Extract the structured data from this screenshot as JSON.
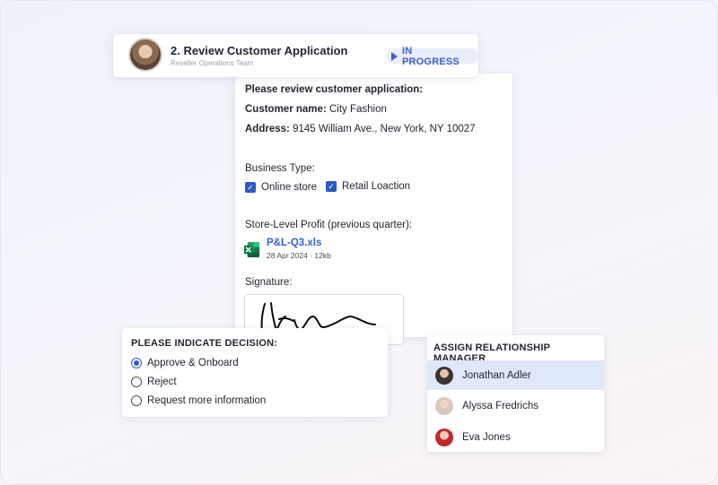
{
  "task": {
    "title": "2. Review Customer Application",
    "team": "Reseller Operations Team",
    "status": "IN PROGRESS",
    "status_color": "#3f5fc4"
  },
  "form": {
    "intro": "Please review customer application:",
    "customer_label": "Customer name:",
    "customer_value": "City Fashion",
    "address_label": "Address:",
    "address_value": "9145 William Ave., New York, NY 10027",
    "business_type_label": "Business Type:",
    "business_types": [
      {
        "label": "Online store",
        "checked": true
      },
      {
        "label": "Retail Loaction",
        "checked": true
      }
    ],
    "profit_label": "Store-Level Profit (previous quarter):",
    "file": {
      "name": "P&L-Q3.xls",
      "meta": "28 Apr 2024 · 12kb",
      "icon": "excel-file-icon"
    },
    "signature_label": "Signature:"
  },
  "decision": {
    "title": "PLEASE INDICATE DECISION:",
    "options": [
      {
        "label": "Approve & Onboard",
        "selected": true
      },
      {
        "label": "Reject",
        "selected": false
      },
      {
        "label": "Request more information",
        "selected": false
      }
    ]
  },
  "manager": {
    "title": "ASSIGN RELATIONSHIP MANAGER",
    "options": [
      {
        "name": "Jonathan Adler",
        "selected": true
      },
      {
        "name": "Alyssa Fredrichs",
        "selected": false
      },
      {
        "name": "Eva Jones",
        "selected": false
      }
    ]
  },
  "colors": {
    "accent": "#2b58c4",
    "link": "#3560c9",
    "excel_green": "#1d7044"
  }
}
